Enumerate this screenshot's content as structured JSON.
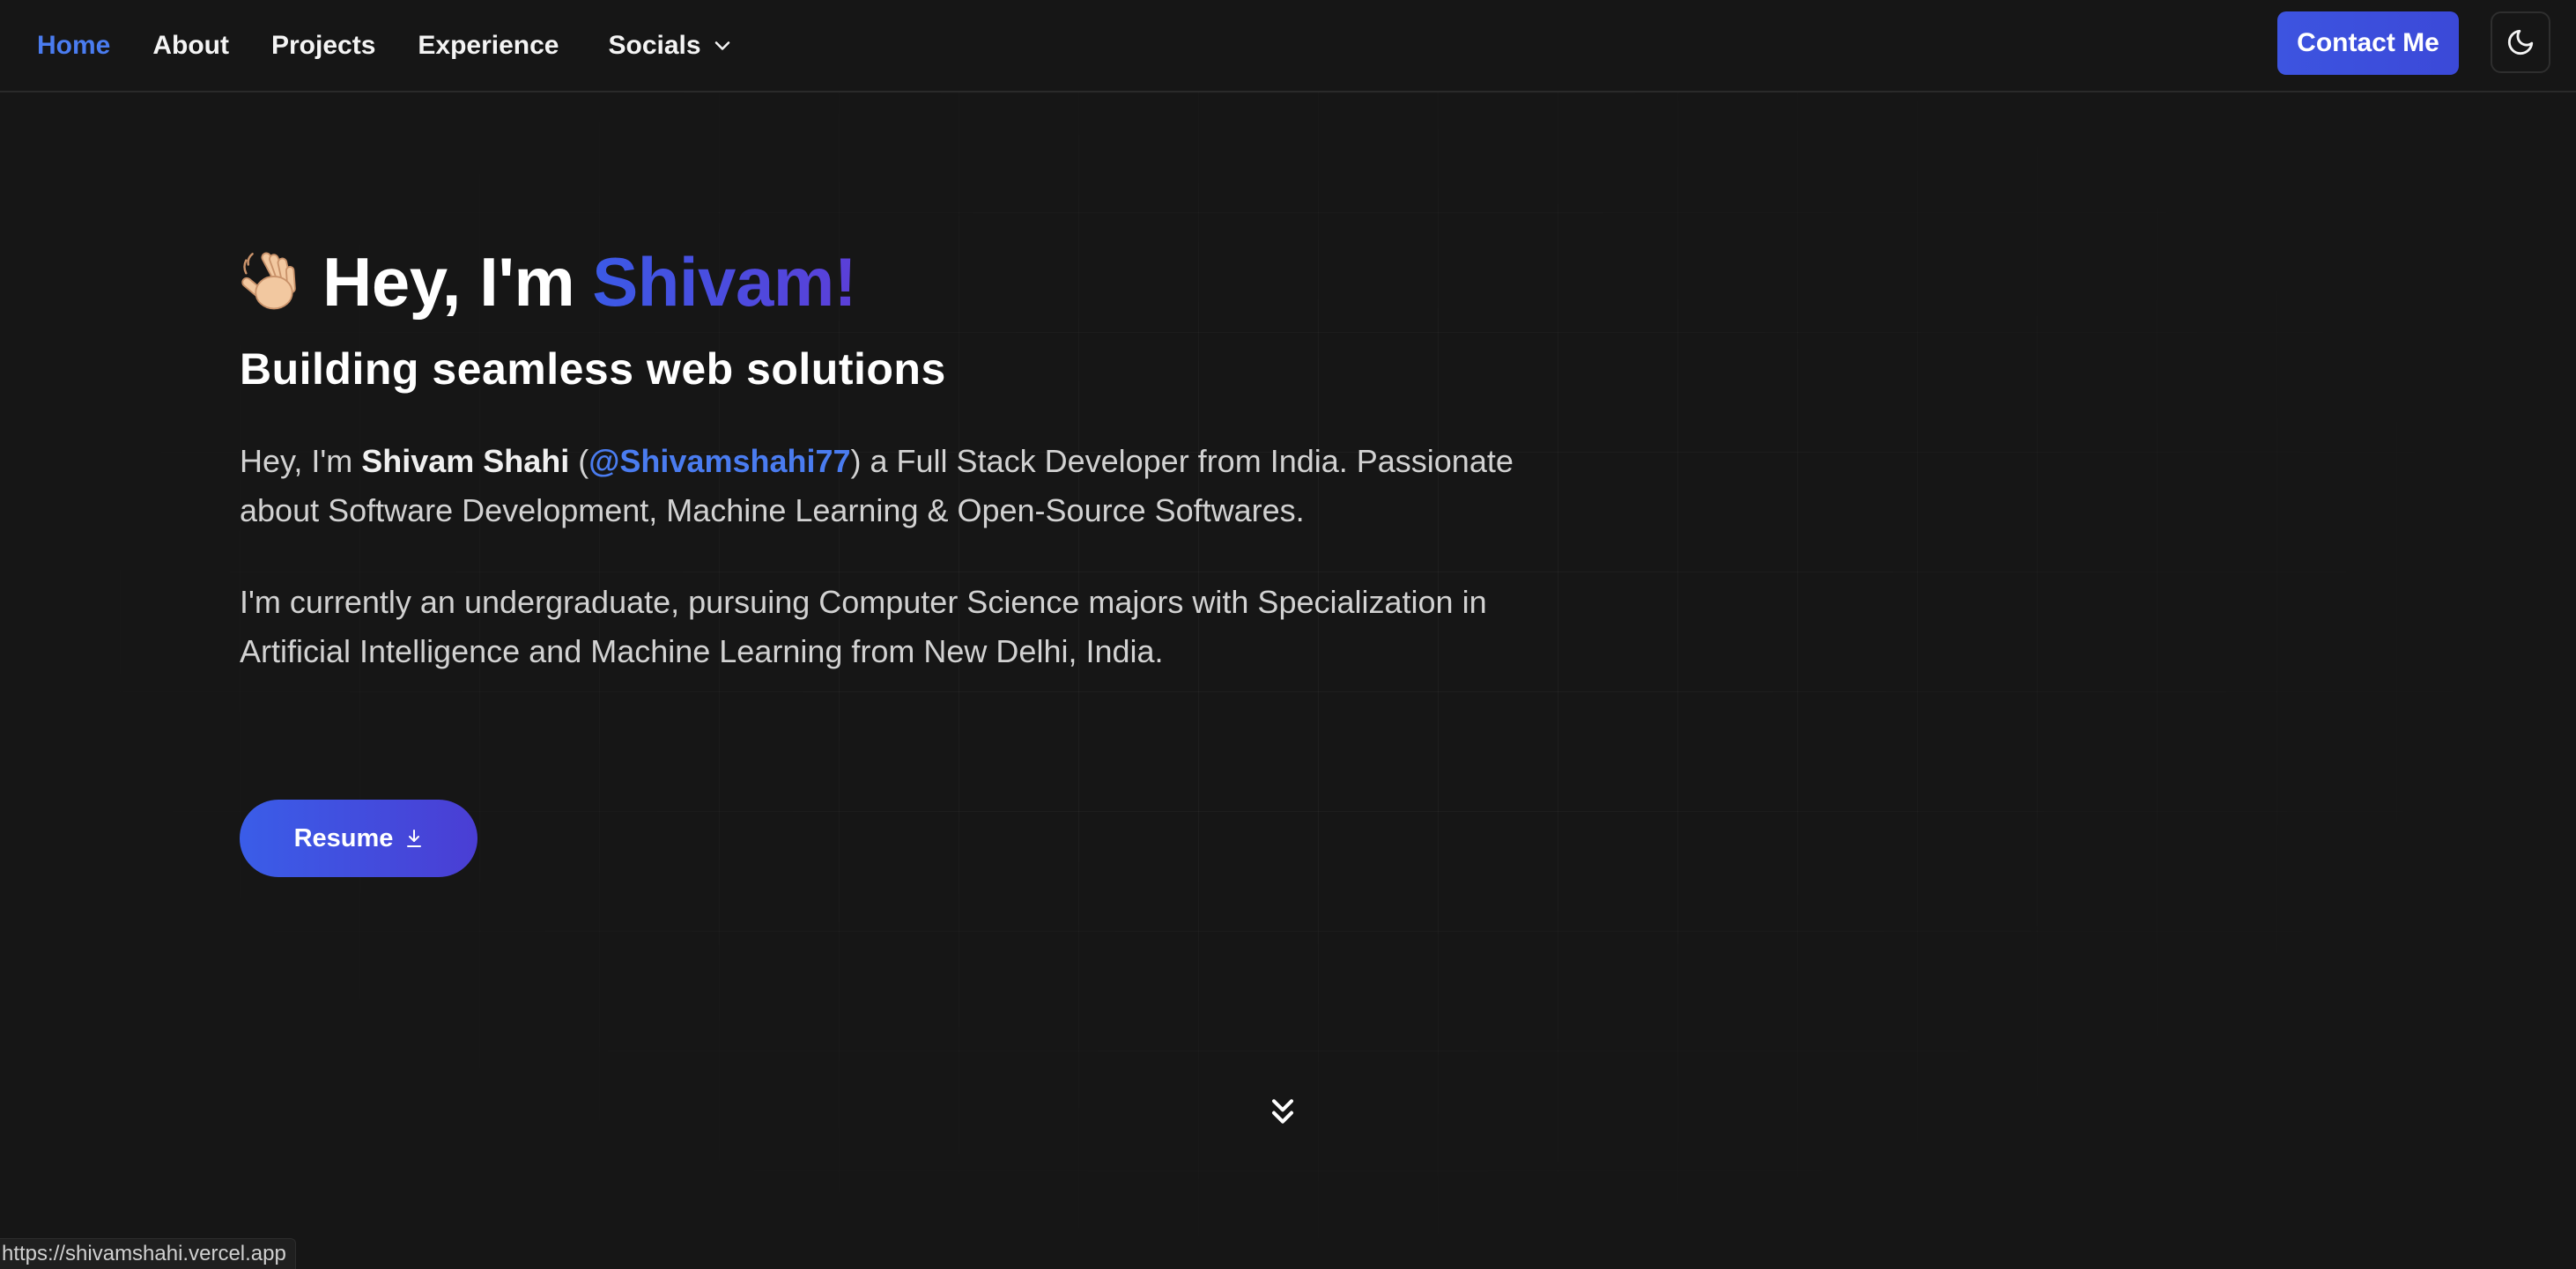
{
  "nav": {
    "items": [
      {
        "label": "Home",
        "active": true
      },
      {
        "label": "About"
      },
      {
        "label": "Projects"
      },
      {
        "label": "Experience"
      }
    ],
    "socials_label": "Socials",
    "socials_icon": "chevron-down-icon",
    "contact_label": "Contact Me",
    "theme_icon": "moon-icon"
  },
  "hero": {
    "wave_icon": "waving-hand-icon",
    "greeting": "Hey, I'm",
    "name": "Shivam!",
    "tagline": "Building seamless web solutions",
    "intro": {
      "prefix": "Hey, I'm ",
      "full_name": "Shivam Shahi",
      "open_paren": " (",
      "handle": "@Shivamshahi77",
      "rest": ") a Full Stack Developer from India. Passionate about Software Development, Machine Learning & Open-Source Softwares."
    },
    "education": "I'm currently an undergraduate, pursuing Computer Science majors with Specialization in Artificial Intelligence and Machine Learning from New Delhi, India.",
    "resume_label": "Resume",
    "resume_icon": "download-icon",
    "scroll_icon": "chevrons-down-icon"
  },
  "status_url": "https://shivamshahi.vercel.app",
  "colors": {
    "background": "#161616",
    "accent": "#3b5ae6",
    "link": "#4a7cf0"
  }
}
